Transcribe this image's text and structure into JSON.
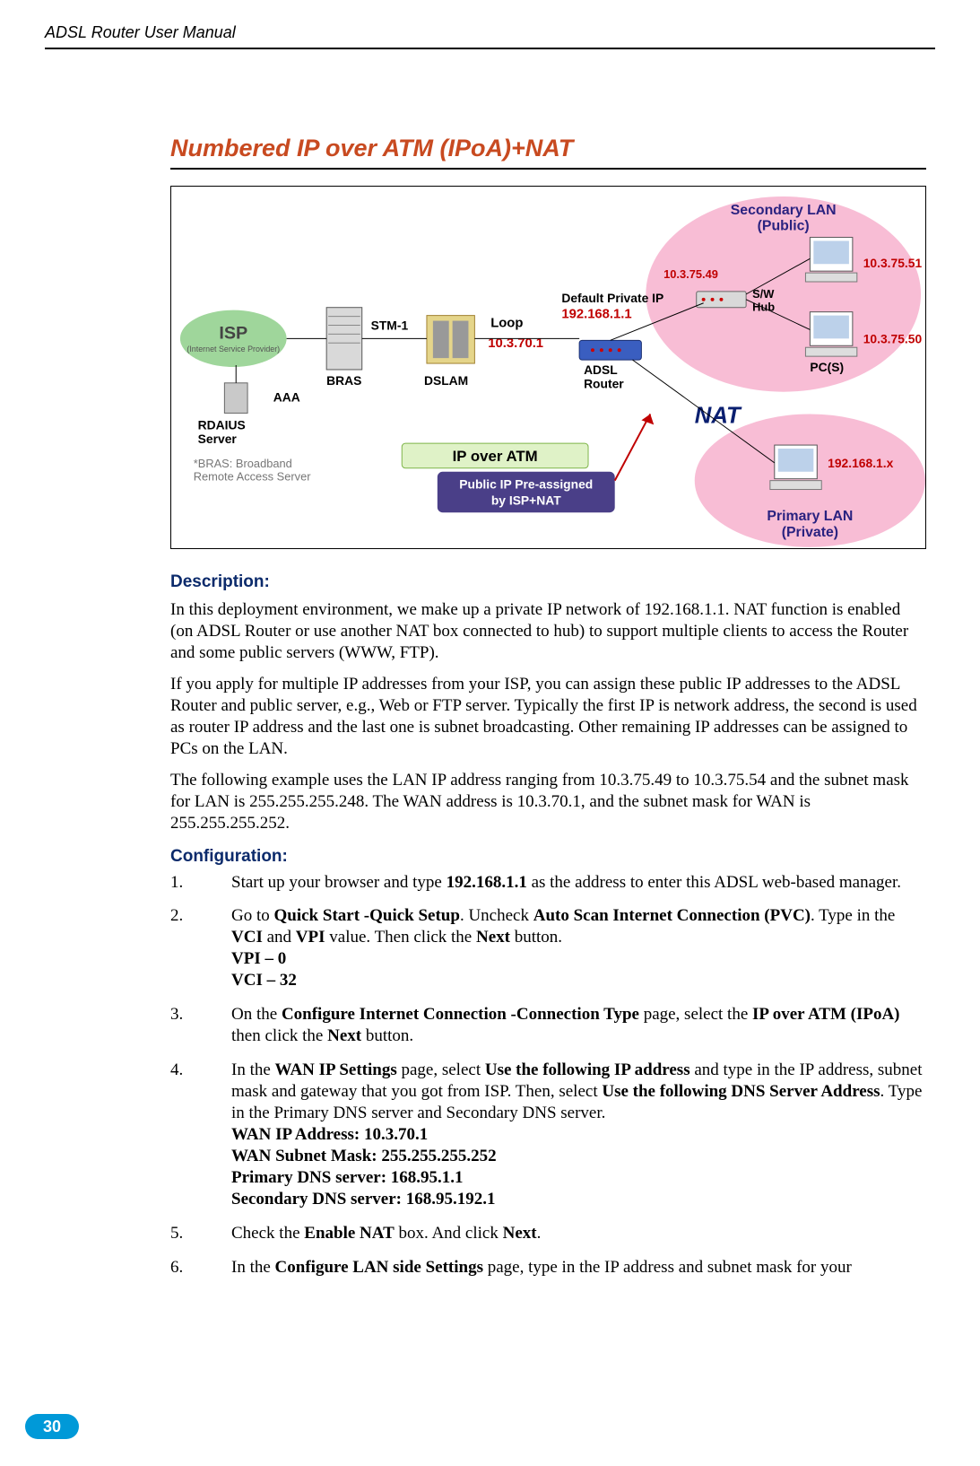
{
  "header": {
    "doc_title": "ADSL Router User Manual"
  },
  "section": {
    "title": "Numbered IP over ATM (IPoA)+NAT"
  },
  "diagram": {
    "isp_label": "ISP",
    "isp_sub": "(Internet Service Provider)",
    "aaa": "AAA",
    "radius": "RDAIUS\nServer",
    "bras_foot": "*BRAS: Broadband\nRemote Access Server",
    "stm1": "STM-1",
    "bras": "BRAS",
    "loop": "Loop",
    "loop_ip": "10.3.70.1",
    "dslam": "DSLAM",
    "default_private": "Default Private IP",
    "default_private_ip": "192.168.1.1",
    "adsl_router": "ADSL\nRouter",
    "sw_hub": "S/W\nHub",
    "secondary_lan": "Secondary  LAN\n(Public)",
    "sec_ip1": "10.3.75.49",
    "sec_ip2": "10.3.75.51",
    "sec_ip3": "10.3.75.50",
    "pcs": "PC(S)",
    "ipoa": "IP over ATM",
    "preassigned": "Public IP Pre-assigned\nby ISP+NAT",
    "nat": "NAT",
    "nat_ip": "192.168.1.x",
    "primary_lan": "Primary LAN\n(Private)"
  },
  "description": {
    "heading": "Description:",
    "p1": "In this deployment environment, we make up a private IP network of 192.168.1.1. NAT function is enabled (on ADSL Router or use another NAT box connected to hub) to support multiple clients to access the Router and some public servers (WWW, FTP).",
    "p2": "If you apply for multiple IP addresses from your ISP, you can assign these public IP addresses to the ADSL Router and public server, e.g., Web or FTP server. Typically the first IP is network address, the second is used as router IP address and the last one is subnet broadcasting. Other remaining IP addresses can be assigned to PCs on the LAN.",
    "p3": "The following example uses the LAN IP address ranging from 10.3.75.49 to 10.3.75.54 and the subnet mask for LAN is 255.255.255.248. The WAN address is 10.3.70.1, and the subnet mask for WAN is 255.255.255.252."
  },
  "configuration": {
    "heading": "Configuration:",
    "step1": {
      "t1": "Start up your browser and type ",
      "b1": "192.168.1.1",
      "t2": " as the address to enter this ADSL web-based manager."
    },
    "step2": {
      "t1": "Go to ",
      "b1": "Quick Start -Quick Setup",
      "t2": ". Uncheck ",
      "b2": "Auto Scan Internet Connection (PVC)",
      "t3": ". Type in the ",
      "b3": "VCI",
      "t4": " and ",
      "b4": "VPI",
      "t5": " value. Then click the ",
      "b5": "Next",
      "t6": " button.",
      "l1": "VPI – 0",
      "l2": "VCI – 32"
    },
    "step3": {
      "t1": "On the ",
      "b1": "Configure Internet Connection -Connection Type",
      "t2": " page, select the ",
      "b2": "IP over ATM (IPoA)",
      "t3": " then click the ",
      "b3": "Next",
      "t4": " button."
    },
    "step4": {
      "t1": "In the ",
      "b1": "WAN IP Settings",
      "t2": " page, select ",
      "b2": "Use the following IP address",
      "t3": " and type in the IP address, subnet mask and gateway that you got from ISP. Then, select ",
      "b3": "Use the following DNS Server Address",
      "t4": ". Type in the Primary DNS server and Secondary DNS server.",
      "l1": "WAN IP Address: 10.3.70.1",
      "l2": "WAN Subnet Mask: 255.255.255.252",
      "l3": "Primary DNS server: 168.95.1.1",
      "l4": "Secondary DNS server: 168.95.192.1"
    },
    "step5": {
      "t1": "Check the ",
      "b1": "Enable NAT",
      "t2": " box. And click ",
      "b2": "Next",
      "t3": "."
    },
    "step6": {
      "t1": "In the ",
      "b1": "Configure LAN side Settings",
      "t2": " page, type in the IP address and subnet mask for your"
    }
  },
  "page_number": "30"
}
